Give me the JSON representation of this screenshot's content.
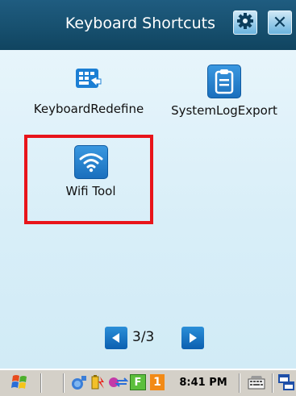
{
  "window": {
    "title": "Keyboard Shortcuts",
    "close_label": "✕"
  },
  "apps": [
    {
      "label": "KeyboardRedefine",
      "icon": "keyboard-redefine-icon"
    },
    {
      "label": "SystemLogExport",
      "icon": "clipboard-icon"
    },
    {
      "label": "Wifi Tool",
      "icon": "wifi-icon"
    }
  ],
  "pager": {
    "text": "3/3"
  },
  "taskbar": {
    "clock": "8:41 PM",
    "flag_label": "F",
    "number_badge": "1"
  },
  "colors": {
    "titlebar": "#17506f",
    "highlight": "#e8141a",
    "icon_blue": "#1c7fd4"
  }
}
